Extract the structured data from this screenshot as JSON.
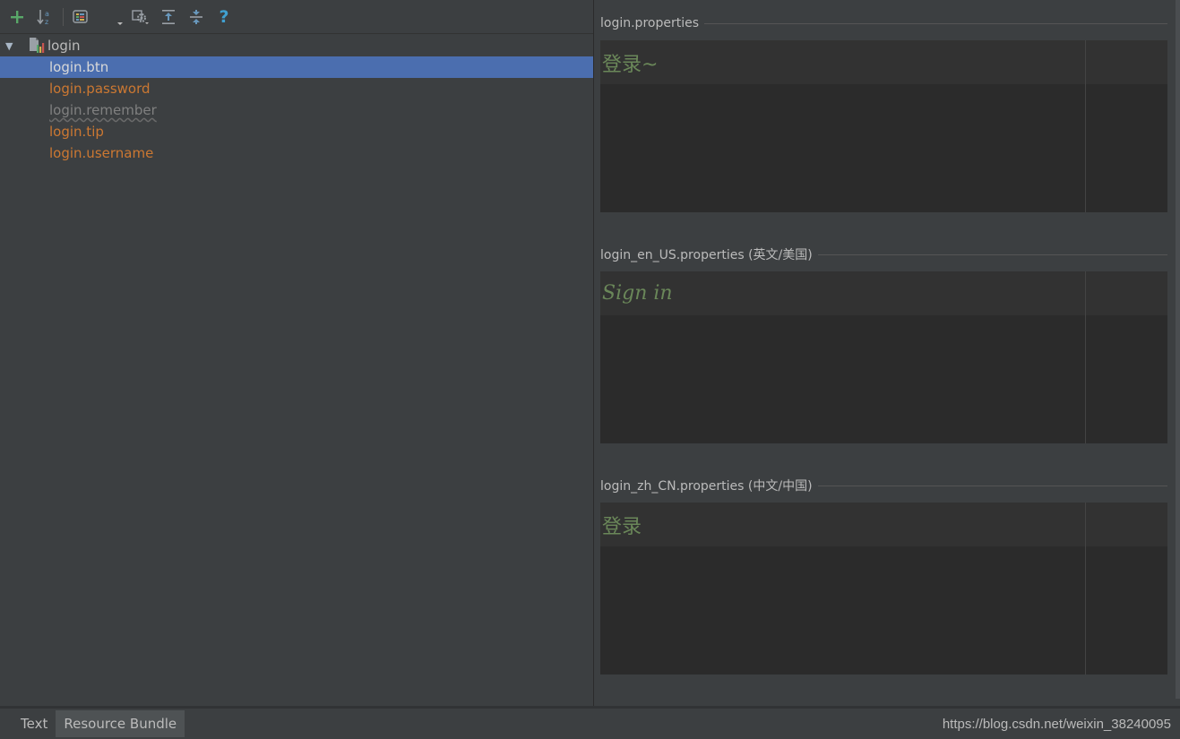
{
  "toolbar": {
    "buttons": [
      {
        "name": "add-property",
        "icon": "plus-icon",
        "color": "#59a869"
      },
      {
        "name": "sort-alphabetically",
        "icon": "sort-az-icon",
        "color": "#6897bb"
      },
      {
        "name": "group-by-prefix",
        "icon": "group-icon",
        "color": "#d0b050"
      },
      {
        "name": "settings",
        "icon": "gear-icon",
        "color": "#9aa0a6"
      },
      {
        "name": "expand-all",
        "icon": "expand-all-icon",
        "color": "#6897bb"
      },
      {
        "name": "collapse-all",
        "icon": "collapse-all-icon",
        "color": "#6897bb"
      },
      {
        "name": "help",
        "icon": "help-icon",
        "color": "#40a0d0"
      }
    ]
  },
  "tree": {
    "root": {
      "label": "login",
      "icon": "resource-bundle-icon"
    },
    "items": [
      {
        "label": "login.btn",
        "state": "selected"
      },
      {
        "label": "login.password",
        "state": "normal"
      },
      {
        "label": "login.remember",
        "state": "unused"
      },
      {
        "label": "login.tip",
        "state": "normal"
      },
      {
        "label": "login.username",
        "state": "normal"
      }
    ]
  },
  "locales": [
    {
      "file": "login.properties",
      "value": "登录~"
    },
    {
      "file": "login_en_US.properties (英文/美国)",
      "value": "Sign in"
    },
    {
      "file": "login_zh_CN.properties (中文/中国)",
      "value": "登录"
    }
  ],
  "bottom_tabs": [
    {
      "label": "Text",
      "active": false
    },
    {
      "label": "Resource Bundle",
      "active": true
    }
  ],
  "status": {
    "url": "https://blog.csdn.net/weixin_38240095"
  },
  "colors": {
    "background": "#3c3f41",
    "selection": "#4b6eaf",
    "key_orange": "#cc7832",
    "value_green": "#6a8759",
    "unused_gray": "#808080"
  }
}
